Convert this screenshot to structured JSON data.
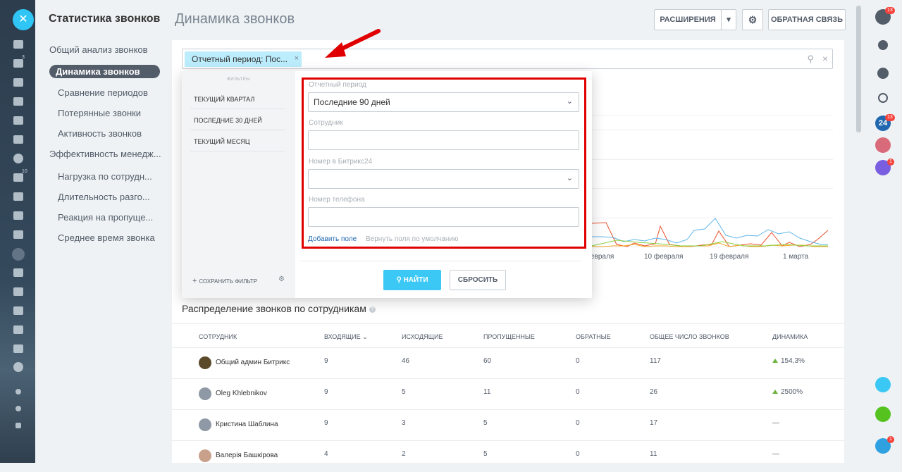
{
  "sidebar": {
    "title": "Статистика звонков",
    "items": [
      {
        "label": "Общий анализ звонков"
      },
      {
        "label": "Динамика звонков"
      },
      {
        "label": "Сравнение периодов"
      },
      {
        "label": "Потерянные звонки"
      },
      {
        "label": "Активность звонков"
      },
      {
        "label": "Эффективность менедж..."
      },
      {
        "label": "Нагрузка по сотрудн..."
      },
      {
        "label": "Длительность разго..."
      },
      {
        "label": "Реакция на пропуще..."
      },
      {
        "label": "Среднее время звонка"
      }
    ]
  },
  "header": {
    "title": "Динамика звонков",
    "extensions_label": "РАСШИРЕНИЯ",
    "feedback_label": "ОБРАТНАЯ СВЯЗЬ"
  },
  "search": {
    "chip_label": "Отчетный период: Пос..."
  },
  "filter": {
    "heading": "ФИЛЬТРЫ",
    "presets": [
      "ТЕКУЩИЙ КВАРТАЛ",
      "ПОСЛЕДНИЕ 30 ДНЕЙ",
      "ТЕКУЩИЙ МЕСЯЦ"
    ],
    "save_label": "СОХРАНИТЬ ФИЛЬТР",
    "period_label": "Отчетный период",
    "period_value": "Последние 90 дней",
    "employee_label": "Сотрудник",
    "bitrix_number_label": "Номер в Битрикс24",
    "phone_label": "Номер телефона",
    "add_field": "Добавить поле",
    "reset_fields": "Вернуть поля по умолчанию",
    "find_label": "НАЙТИ",
    "reset_label": "СБРОСИТЬ"
  },
  "chart_axis": {
    "x_labels": [
      "евраля",
      "10 февраля",
      "19 февраля",
      "1 марта"
    ]
  },
  "table": {
    "title": "Распределение звонков по сотрудникам",
    "columns": [
      "СОТРУДНИК",
      "ВХОДЯЩИЕ",
      "ИСХОДЯЩИЕ",
      "ПРОПУЩЕННЫЕ",
      "ОБРАТНЫЕ",
      "ОБЩЕЕ ЧИСЛО ЗВОНКОВ",
      "ДИНАМИКА"
    ],
    "rows": [
      {
        "name": "Общий админ Битрикс",
        "incoming": "9",
        "outgoing": "46",
        "missed": "60",
        "callback": "0",
        "total": "117",
        "dynamics": "154,3%"
      },
      {
        "name": "Oleg Khlebnikov",
        "incoming": "9",
        "outgoing": "5",
        "missed": "11",
        "callback": "0",
        "total": "26",
        "dynamics": "2500%"
      },
      {
        "name": "Кристина Шаблина",
        "incoming": "9",
        "outgoing": "3",
        "missed": "5",
        "callback": "0",
        "total": "17",
        "dynamics": "—"
      },
      {
        "name": "Валерія Башкірова",
        "incoming": "4",
        "outgoing": "2",
        "missed": "5",
        "callback": "0",
        "total": "11",
        "dynamics": "—"
      }
    ]
  },
  "right_rail": {
    "help_badge": "13",
    "b24_badge": "13",
    "phone_badge": "1",
    "edu_badge": "1",
    "b24_label": "24"
  },
  "colors": {
    "accent": "#3bc8f5",
    "highlight": "#e00000",
    "rail": "#2d3d4d"
  }
}
